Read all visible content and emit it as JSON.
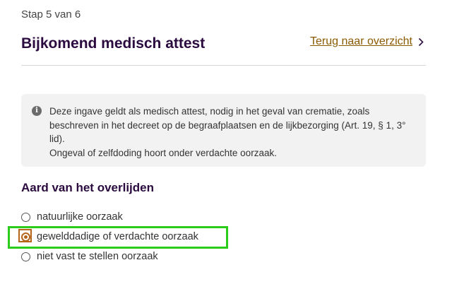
{
  "header": {
    "step_label": "Stap 5 van 6",
    "title": "Bijkomend medisch attest",
    "back_link": "Terug naar overzicht"
  },
  "info": {
    "icon": "info-icon",
    "line1": "Deze ingave geldt als medisch attest, nodig in het geval van crematie, zoals beschreven in het decreet op de begraafplaatsen en de lijkbezorging (Art. 19, § 1, 3° lid).",
    "line2": "Ongeval of zelfdoding hoort onder verdachte oorzaak."
  },
  "section": {
    "title": "Aard van het overlijden",
    "options": [
      {
        "label": "natuurlijke oorzaak",
        "selected": false
      },
      {
        "label": "gewelddadige of verdachte oorzaak",
        "selected": true
      },
      {
        "label": "niet vast te stellen oorzaak",
        "selected": false
      }
    ]
  },
  "colors": {
    "title": "#2b0b3f",
    "link": "#8a5a00",
    "accent": "#b5661a",
    "highlight": "#2ecc1a",
    "info_bg": "#f2f2f2"
  }
}
